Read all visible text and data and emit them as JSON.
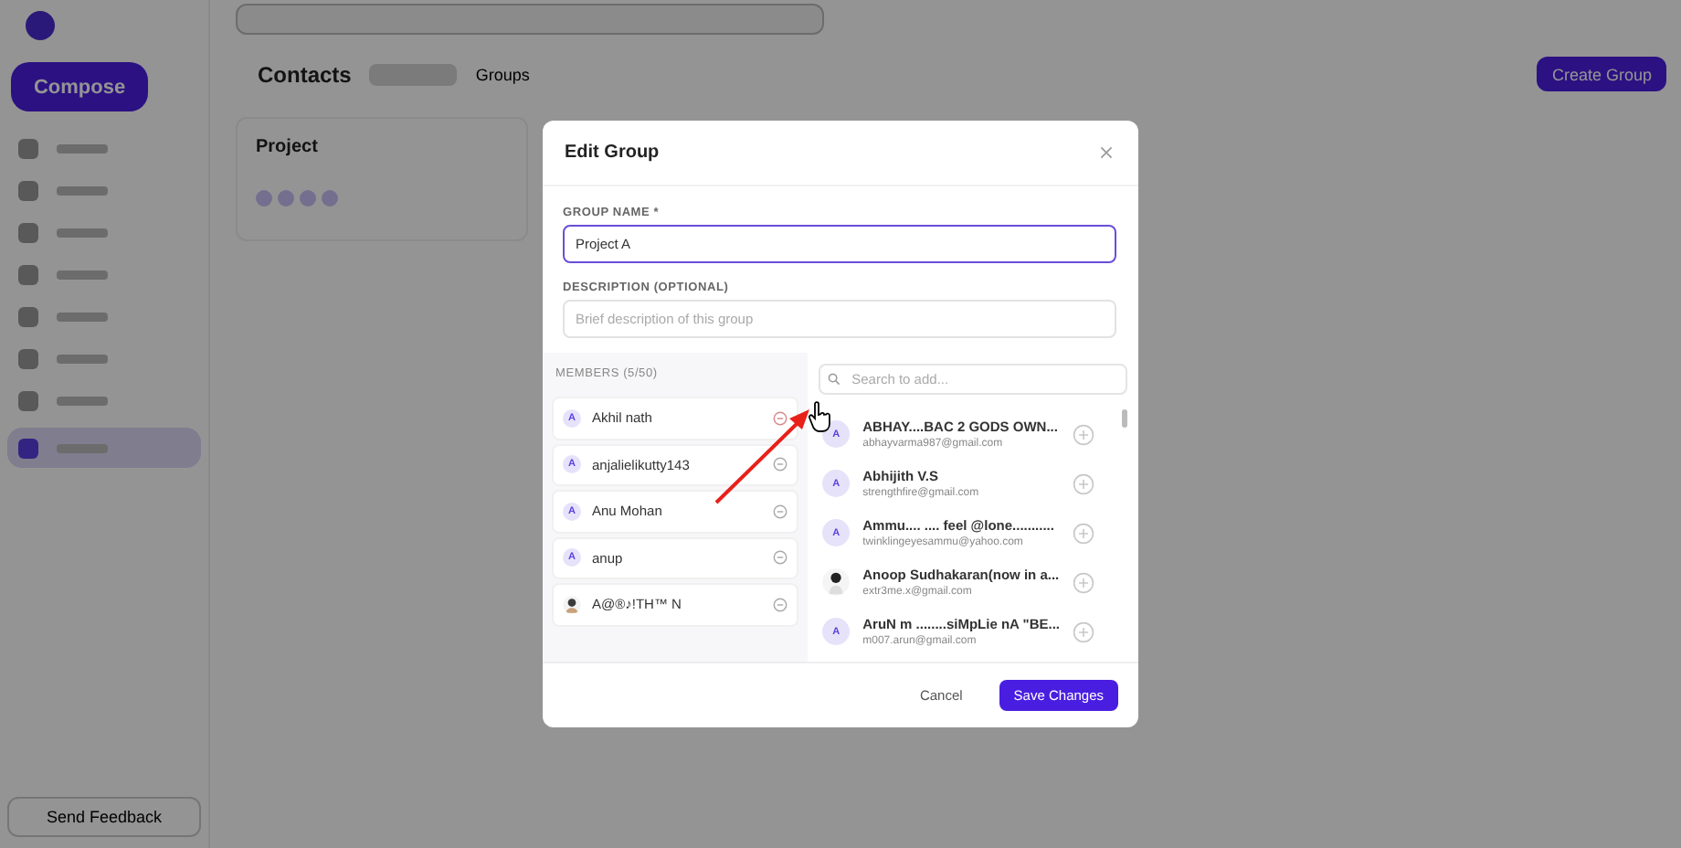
{
  "app": {
    "compose_label": "Compose",
    "feedback_label": "Send Feedback",
    "page_title": "Contacts",
    "tab": "Groups",
    "create_button": "Create Group",
    "group_card": {
      "title": "Project"
    }
  },
  "dialog": {
    "title": "Edit Group",
    "name_field": {
      "label": "GROUP NAME *",
      "value": "Project A"
    },
    "description_field": {
      "label": "DESCRIPTION (OPTIONAL)",
      "placeholder": "Brief description of this group"
    },
    "members_heading": "MEMBERS (5/50)",
    "members": [
      {
        "name": "Akhil nath",
        "avatar": "A",
        "hovered": true
      },
      {
        "name": "anjalielikutty143",
        "avatar": "A",
        "hovered": false
      },
      {
        "name": "Anu Mohan",
        "avatar": "A",
        "hovered": false
      },
      {
        "name": "anup",
        "avatar": "A",
        "hovered": false
      },
      {
        "name": "A@®♪!TH™ N",
        "kind": "picture",
        "hovered": false
      }
    ],
    "search": {
      "placeholder": "Search to add..."
    },
    "contacts": [
      {
        "name": "ABHAY....BAC 2 GODS OWN...",
        "email": "abhayvarma987@gmail.com",
        "avatar": "A"
      },
      {
        "name": "Abhijith V.S",
        "email": "strengthfire@gmail.com",
        "avatar": "A"
      },
      {
        "name": "Ammu.... .... feel @lone...........",
        "email": "twinklingeyesammu@yahoo.com",
        "avatar": "A"
      },
      {
        "name": "Anoop Sudhakaran(now in a...",
        "email": "extr3me.x@gmail.com",
        "kind": "picture"
      },
      {
        "name": "AruN m ........siMpLie nA \"BE...",
        "email": "m007.arun@gmail.com",
        "avatar": "A"
      }
    ],
    "buttons": {
      "cancel": "Cancel",
      "save": "Save Changes"
    }
  }
}
